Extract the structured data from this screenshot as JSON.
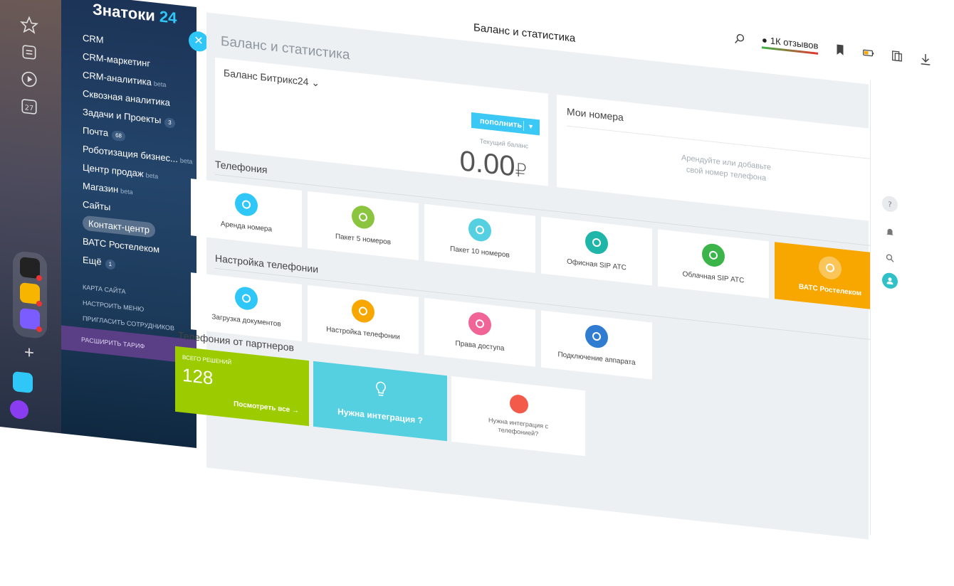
{
  "browser": {
    "title": "Баланс и статистика",
    "reviews": "1К отзывов"
  },
  "sidebar": {
    "brand": "Знатоки",
    "brand_num": "24",
    "items": [
      {
        "label": "CRM",
        "beta": "",
        "badge": ""
      },
      {
        "label": "CRM-маркетинг",
        "beta": "",
        "badge": ""
      },
      {
        "label": "CRM-аналитика",
        "beta": "beta",
        "badge": ""
      },
      {
        "label": "Сквозная аналитика",
        "beta": "",
        "badge": ""
      },
      {
        "label": "Задачи и Проекты",
        "beta": "",
        "badge": "3"
      },
      {
        "label": "Почта",
        "beta": "",
        "badge": "68"
      },
      {
        "label": "Роботизация бизнес...",
        "beta": "beta",
        "badge": ""
      },
      {
        "label": "Центр продаж",
        "beta": "beta",
        "badge": ""
      },
      {
        "label": "Магазин",
        "beta": "beta",
        "badge": ""
      },
      {
        "label": "Сайты",
        "beta": "",
        "badge": ""
      },
      {
        "label": "Контакт-центр",
        "beta": "",
        "badge": ""
      },
      {
        "label": "ВАТС Ростелеком",
        "beta": "",
        "badge": ""
      },
      {
        "label": "Ещё",
        "beta": "",
        "badge": "1"
      }
    ],
    "small_links": [
      "Карта сайта",
      "Настроить меню",
      "Пригласить сотрудников"
    ],
    "tariff": "Расширить тариф"
  },
  "main": {
    "page_title": "Баланс и статистика",
    "balance": {
      "title": "Баланс Битрикс24",
      "topup": "пополнить",
      "current_label": "Текущий баланс",
      "value": "0.00",
      "currency": "₽"
    },
    "numbers": {
      "title": "Мои номера",
      "empty_line1": "Арендуйте или добавьте",
      "empty_line2": "свой номер телефона"
    },
    "sections": {
      "telephony": "Телефония",
      "settings": "Настройка телефонии",
      "partners": "Телефония от партнеров"
    },
    "telephony_tiles": [
      {
        "label": "Аренда номера",
        "color": "#2fc7f7"
      },
      {
        "label": "Пакет 5 номеров",
        "color": "#8bc43f"
      },
      {
        "label": "Пакет 10 номеров",
        "color": "#55d0e0"
      },
      {
        "label": "Офисная SIP АТС",
        "color": "#1fb5a8"
      },
      {
        "label": "Облачная SIP АТС",
        "color": "#3bb54a"
      },
      {
        "label": "ВАТС Ростелеком",
        "color": "#f7a700"
      }
    ],
    "settings_tiles": [
      {
        "label": "Загрузка документов",
        "color": "#2fc7f7"
      },
      {
        "label": "Настройка телефонии",
        "color": "#f7a700"
      },
      {
        "label": "Права доступа",
        "color": "#f06595"
      },
      {
        "label": "Подключение аппарата",
        "color": "#2f7cd1"
      }
    ],
    "partners": {
      "total_label": "Всего решений",
      "total": "128",
      "view_all": "Посмотреть все",
      "need_integration": "Нужна интеграция ?",
      "need_integration_phone_1": "Нужна интеграция с",
      "need_integration_phone_2": "телефонией?"
    }
  }
}
